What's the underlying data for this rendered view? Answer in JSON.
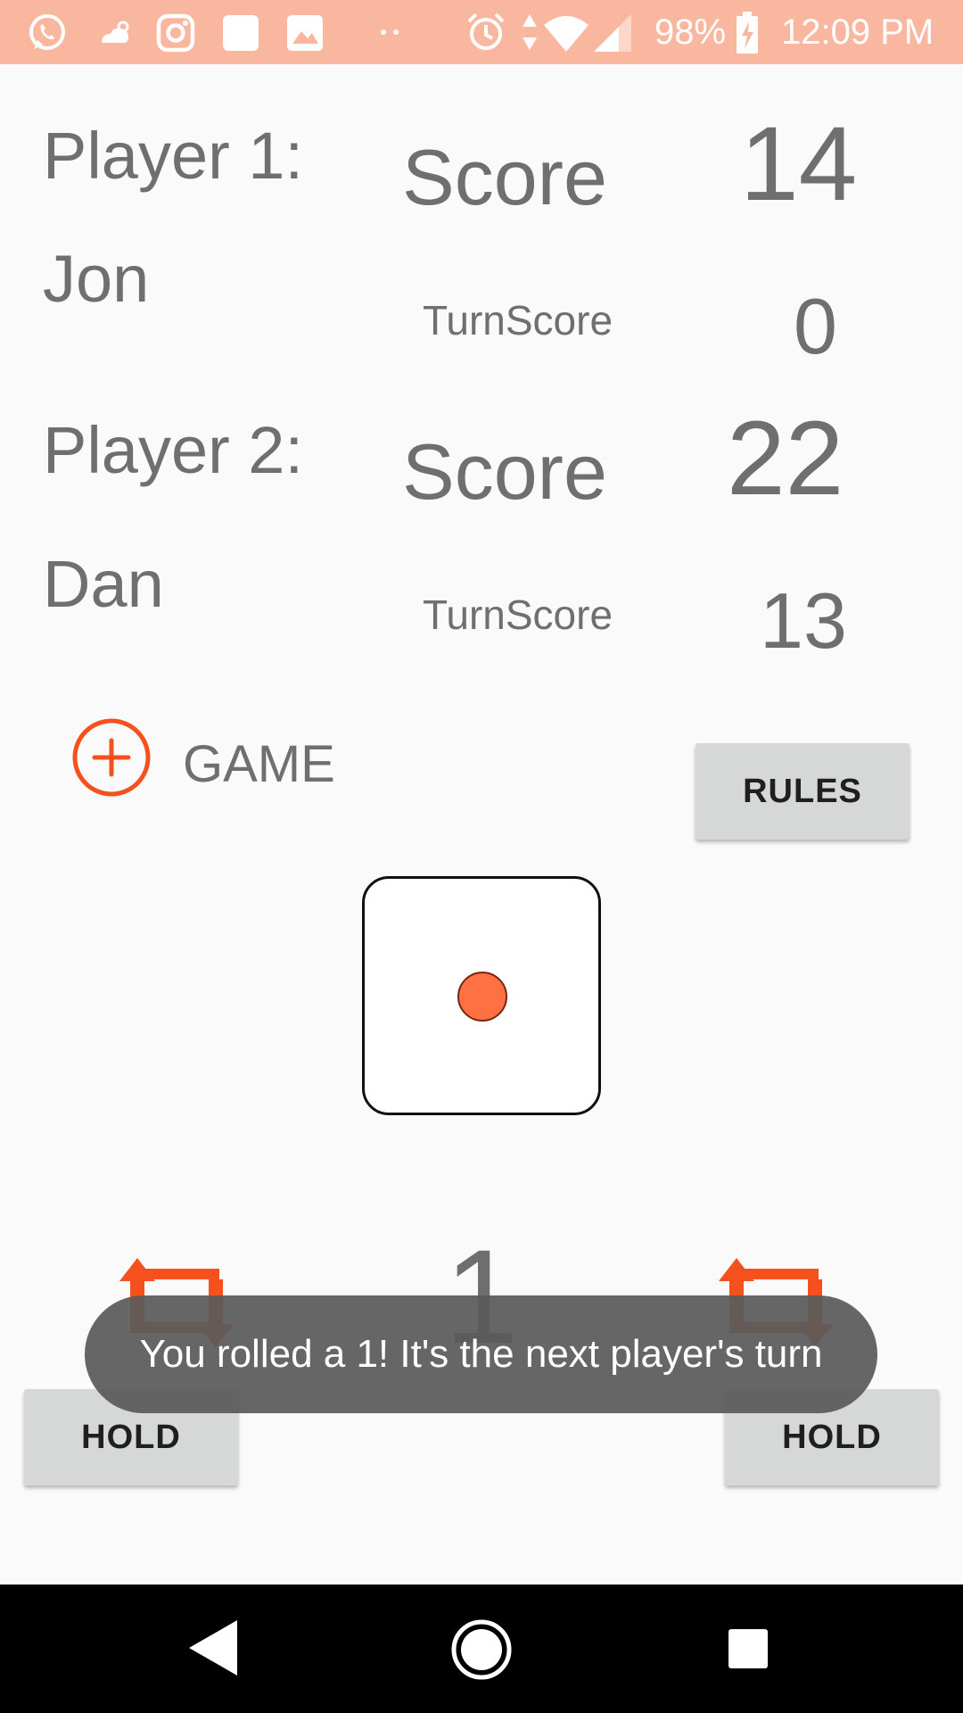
{
  "status_bar": {
    "battery": "98%",
    "time": "12:09 PM",
    "icons": [
      "whatsapp-icon",
      "weather-icon",
      "instagram-icon",
      "app-square-icon",
      "gallery-icon",
      "more-dots-icon",
      "alarm-icon",
      "data-arrows-icon",
      "wifi-icon",
      "signal-icon",
      "battery-charging-icon"
    ],
    "background": "#f9b79f"
  },
  "player1": {
    "label": "Player 1:",
    "name": "Jon",
    "score_label": "Score",
    "score": "14",
    "turn_label": "TurnScore",
    "turn_score": "0"
  },
  "player2": {
    "label": "Player 2:",
    "name": "Dan",
    "score_label": "Score",
    "score": "22",
    "turn_label": "TurnScore",
    "turn_score": "13"
  },
  "new_game": {
    "label": "GAME",
    "icon": "add-circle-icon"
  },
  "rules_button": "RULES",
  "die": {
    "face": 1,
    "pip_color": "#ff7043"
  },
  "roll": {
    "value": "1",
    "icon": "repeat-icon"
  },
  "hold_left": "HOLD",
  "hold_right": "HOLD",
  "toast": "You rolled a 1! It's the next player's turn",
  "accent_color": "#f4511e",
  "nav": {
    "icons": [
      "back-icon",
      "home-icon",
      "recents-icon"
    ]
  }
}
